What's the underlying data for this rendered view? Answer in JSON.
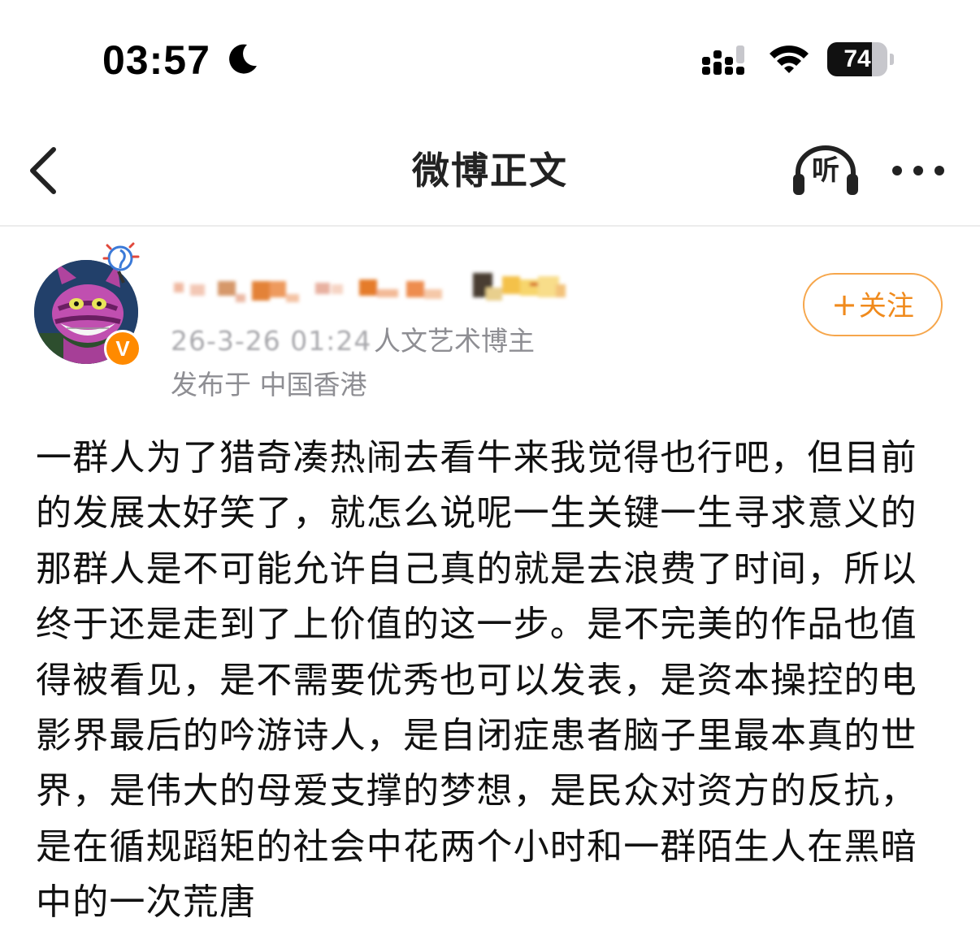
{
  "status_bar": {
    "time": "03:57",
    "battery_level": "74",
    "battery_fraction": 0.74,
    "icons": [
      "moon-icon",
      "cellular-signal-icon",
      "wifi-icon",
      "battery-icon"
    ]
  },
  "nav": {
    "title": "微博正文",
    "listen_label": "听",
    "icons": [
      "back-chevron-icon",
      "headphones-icon",
      "more-dots-icon"
    ]
  },
  "post": {
    "author": {
      "verified_badge": "V",
      "category": "人文艺术博主"
    },
    "published_time": "26-3-26 01:24",
    "location": "发布于 中国香港",
    "follow_label": "关注",
    "follow_plus": "+",
    "text": "一群人为了猎奇凑热闹去看牛来我觉得也行吧，但目前的发展太好笑了，就怎么说呢一生关键一生寻求意义的那群人是不可能允许自己真的就是去浪费了时间，所以终于还是走到了上价值的这一步。是不完美的作品也值得被看见，是不需要优秀也可以发表，是资本操控的电影界最后的吟游诗人，是自闭症患者脑子里最本真的世界，是伟大的母爱支撑的梦想，是民众对资方的反抗，是在循规蹈矩的社会中花两个小时和一群陌生人在黑暗中的一次荒唐"
  },
  "colors": {
    "accent_orange": "#f08a1c",
    "follow_border": "#f6a64b",
    "meta_gray": "#8e8e93",
    "divider": "#ececec"
  }
}
